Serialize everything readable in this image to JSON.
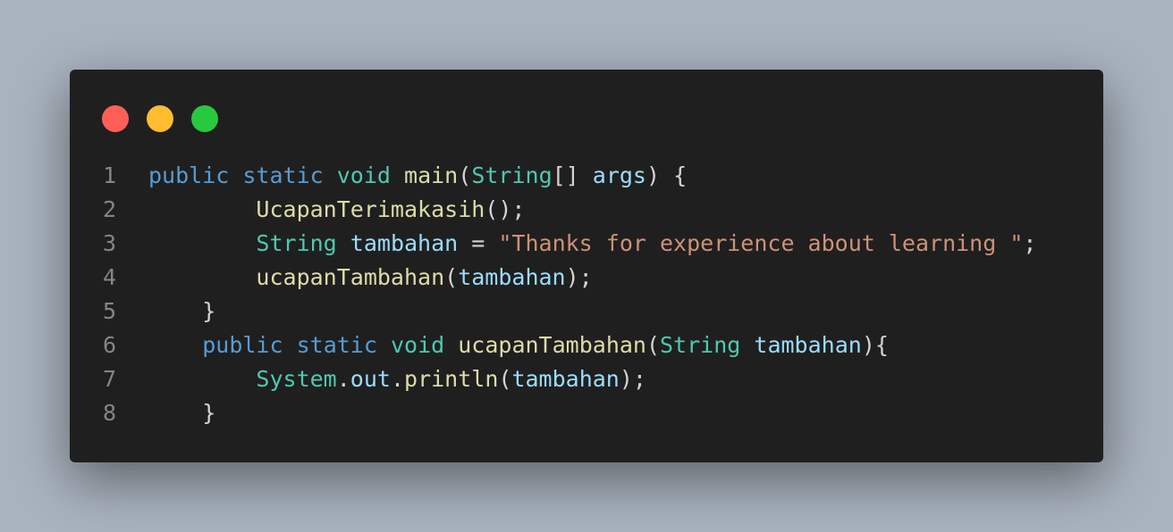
{
  "window": {
    "controls": [
      {
        "name": "close",
        "color": "#ff5f57"
      },
      {
        "name": "minimize",
        "color": "#febc2e"
      },
      {
        "name": "maximize",
        "color": "#28c840"
      }
    ]
  },
  "colors": {
    "keyword": "#569cd6",
    "type": "#4ec9b0",
    "function": "#dcdcaa",
    "variable": "#9cdcfe",
    "string": "#ce9178",
    "punct": "#d4d4d4"
  },
  "code": {
    "lines": [
      {
        "number": "1",
        "tokens": [
          {
            "t": "public",
            "c": "keyword"
          },
          {
            "t": " ",
            "c": "punct"
          },
          {
            "t": "static",
            "c": "keyword"
          },
          {
            "t": " ",
            "c": "punct"
          },
          {
            "t": "void",
            "c": "type"
          },
          {
            "t": " ",
            "c": "punct"
          },
          {
            "t": "main",
            "c": "function"
          },
          {
            "t": "(",
            "c": "punct"
          },
          {
            "t": "String",
            "c": "type"
          },
          {
            "t": "[] ",
            "c": "punct"
          },
          {
            "t": "args",
            "c": "variable"
          },
          {
            "t": ") {",
            "c": "punct"
          }
        ]
      },
      {
        "number": "2",
        "tokens": [
          {
            "t": "        ",
            "c": "punct"
          },
          {
            "t": "UcapanTerimakasih",
            "c": "function"
          },
          {
            "t": "();",
            "c": "punct"
          }
        ]
      },
      {
        "number": "3",
        "tokens": [
          {
            "t": "        ",
            "c": "punct"
          },
          {
            "t": "String",
            "c": "type"
          },
          {
            "t": " ",
            "c": "punct"
          },
          {
            "t": "tambahan",
            "c": "variable"
          },
          {
            "t": " = ",
            "c": "punct"
          },
          {
            "t": "\"Thanks for experience about learning \"",
            "c": "string"
          },
          {
            "t": ";",
            "c": "punct"
          }
        ]
      },
      {
        "number": "4",
        "tokens": [
          {
            "t": "        ",
            "c": "punct"
          },
          {
            "t": "ucapanTambahan",
            "c": "function"
          },
          {
            "t": "(",
            "c": "punct"
          },
          {
            "t": "tambahan",
            "c": "variable"
          },
          {
            "t": ");",
            "c": "punct"
          }
        ]
      },
      {
        "number": "5",
        "tokens": [
          {
            "t": "    }",
            "c": "punct"
          }
        ]
      },
      {
        "number": "6",
        "tokens": [
          {
            "t": "    ",
            "c": "punct"
          },
          {
            "t": "public",
            "c": "keyword"
          },
          {
            "t": " ",
            "c": "punct"
          },
          {
            "t": "static",
            "c": "keyword"
          },
          {
            "t": " ",
            "c": "punct"
          },
          {
            "t": "void",
            "c": "type"
          },
          {
            "t": " ",
            "c": "punct"
          },
          {
            "t": "ucapanTambahan",
            "c": "function"
          },
          {
            "t": "(",
            "c": "punct"
          },
          {
            "t": "String",
            "c": "type"
          },
          {
            "t": " ",
            "c": "punct"
          },
          {
            "t": "tambahan",
            "c": "variable"
          },
          {
            "t": "){",
            "c": "punct"
          }
        ]
      },
      {
        "number": "7",
        "tokens": [
          {
            "t": "        ",
            "c": "punct"
          },
          {
            "t": "System",
            "c": "type"
          },
          {
            "t": ".",
            "c": "punct"
          },
          {
            "t": "out",
            "c": "variable"
          },
          {
            "t": ".",
            "c": "punct"
          },
          {
            "t": "println",
            "c": "function"
          },
          {
            "t": "(",
            "c": "punct"
          },
          {
            "t": "tambahan",
            "c": "variable"
          },
          {
            "t": ");",
            "c": "punct"
          }
        ]
      },
      {
        "number": "8",
        "tokens": [
          {
            "t": "    }",
            "c": "punct"
          }
        ]
      }
    ]
  }
}
